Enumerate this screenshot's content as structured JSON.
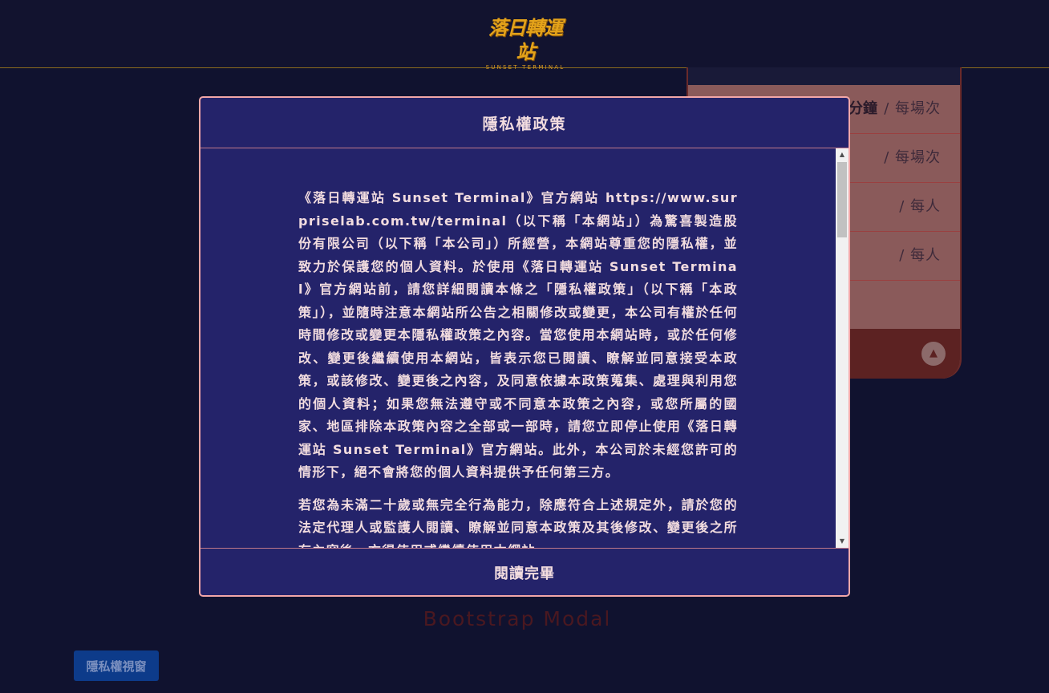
{
  "header": {
    "logo_title": "落日轉運站",
    "logo_subtitle": "SUNSET TERMINAL"
  },
  "price_card": {
    "rows": [
      {
        "label": "分鐘",
        "unit": "/ 每場次"
      },
      {
        "label": "",
        "unit": "/ 每場次"
      },
      {
        "label": "",
        "unit": "/ 每人"
      },
      {
        "label": "",
        "unit": "/ 每人"
      }
    ],
    "scroll_top_icon": "triangle-up-icon"
  },
  "page": {
    "bootstrap_label": "Bootstrap Modal",
    "privacy_button_label": "隱私權視窗"
  },
  "modal": {
    "title": "隱私權政策",
    "paragraphs": [
      "《落日轉運站 Sunset Terminal》官方網站 https://www.surpriselab.com.tw/terminal（以下稱「本網站」）為驚喜製造股份有限公司（以下稱「本公司」）所經營，本網站尊重您的隱私權，並致力於保護您的個人資料。於使用《落日轉運站 Sunset Terminal》官方網站前，請您詳細閱讀本條之「隱私權政策」（以下稱「本政策」），並隨時注意本網站所公告之相關修改或變更，本公司有權於任何時間修改或變更本隱私權政策之內容。當您使用本網站時，或於任何修改、變更後繼續使用本網站，皆表示您已閱讀、瞭解並同意接受本政策，或該修改、變更後之內容，及同意依據本政策蒐集、處理與利用您的個人資料；如果您無法遵守或不同意本政策之內容，或您所屬的國家、地區排除本政策內容之全部或一部時，請您立即停止使用《落日轉運站 Sunset Terminal》官方網站。此外，本公司於未經您許可的情形下，絕不會將您的個人資料提供予任何第三方。",
      "若您為未滿二十歲或無完全行為能力，除應符合上述規定外，請於您的法定代理人或監護人閱讀、瞭解並同意本政策及其後修改、變更後之所有內容後，方得使用或繼續使用本網站。"
    ],
    "footer_label": "閱讀完畢"
  }
}
